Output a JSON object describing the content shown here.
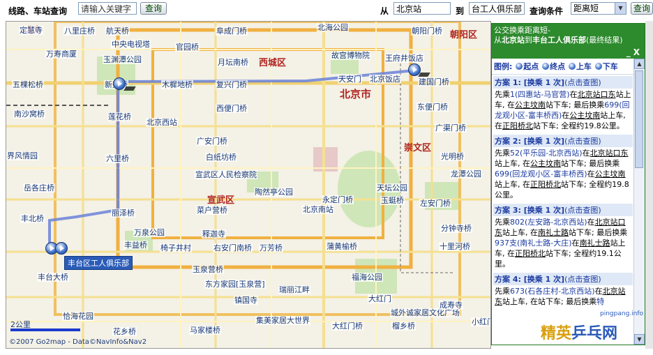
{
  "toolbar": {
    "route_label": "线路、车站查询",
    "keyword_value": "请输入关键字",
    "query_button": "查询",
    "from_label": "从",
    "from_value": "北京站",
    "to_label": "到",
    "to_value": "台工人俱乐部",
    "condition_label": "查询条件",
    "condition_value": "距离短",
    "query_button_2": "查询"
  },
  "map": {
    "districts": [
      "西城区",
      "朝阳区",
      "崇文区",
      "宣武区",
      "北京市",
      "北京"
    ],
    "places": [
      "定慧寺",
      "八里庄桥",
      "航天桥",
      "阜成门桥",
      "北海公园",
      "朝阳门桥",
      "中央电视塔",
      "官园桥",
      "玉渊潭公园",
      "故宫博物院",
      "王府井饭店",
      "万寿商厦",
      "月坛南桥",
      "新兴桥",
      "木樨地桥",
      "复兴门桥",
      "天安门",
      "北京饭店",
      "建国门桥",
      "五棵松桥",
      "北京西站",
      "西便门桥",
      "东便门桥",
      "莲花桥",
      "广安门桥",
      "广渠门桥",
      "白纸坊桥",
      "光明桥",
      "六里桥",
      "宣武区人民检察院",
      "天坛公园",
      "龙潭公园",
      "岳各庄桥",
      "陶然亭公园",
      "左安门桥",
      "永定门桥",
      "玉蜓桥",
      "丰北桥",
      "菜户营桥",
      "北京南站",
      "丽泽桥",
      "万泉公园",
      "分钟寺桥",
      "释迦寺",
      "丰益桥",
      "右安门南桥",
      "万芳桥",
      "蒲黄榆桥",
      "十里河桥",
      "椅子井村",
      "玉泉营桥",
      "丰台大桥",
      "东方家园[玉泉营]",
      "瑞丽江畔",
      "福海公园",
      "镇国寺",
      "大红门",
      "恰海花园",
      "集美家居大世界",
      "城外诚家居文化广场",
      "花乡桥",
      "马家楼桥",
      "大红门桥",
      "榴乡桥",
      "成寿寺",
      "小红门",
      "界风情园",
      "南沙窝桥"
    ],
    "end_label": "丰台区工人俱乐部",
    "scale_label": "2公里",
    "copyright": "©2007 Go2map - Data©NavInfo&Nav2"
  },
  "panel": {
    "header_line1": "公交换乘距离短-",
    "header_from_prefix": "从",
    "header_from": "北京站",
    "header_to_prefix": "到",
    "header_to": "丰台工人俱乐部",
    "header_suffix": "(最终结果)",
    "minimize": "_",
    "close": "X",
    "legend_label": "图例:",
    "legend_start": "起点",
    "legend_end": "终点",
    "legend_on": "上车",
    "legend_off": "下车",
    "schemes": [
      {
        "title": "方案 1: [换乘 1 次]",
        "link": "(点击查图)",
        "p1": "先乘",
        "bus1": "1(四惠站-马官营)",
        "p2": "在",
        "stop1": "北京站口东",
        "p3": "站上车, 在",
        "stop2": "公主坟南",
        "p4": "站下车; 最后换乘",
        "bus2": "699(回龙观小区-富丰桥西)",
        "p5": "在",
        "stop3": "公主坟南",
        "p6": "站上车, 在",
        "stop4": "正阳桥北",
        "p7": "站下车; 全程约19.8公里。"
      },
      {
        "title": "方案 2: [换乘 1 次]",
        "link": "(点击查图)",
        "p1": "先乘",
        "bus1": "52(平乐园-北京西站)",
        "p2": "在",
        "stop1": "北京站口东",
        "p3": "站上车, 在",
        "stop2": "公主坟南",
        "p4": "站下车; 最后换乘",
        "bus2": "699(回龙观小区-富丰桥西)",
        "p5": "在",
        "stop3": "公主坟南",
        "p6": "站上车, 在",
        "stop4": "正阳桥北",
        "p7": "站下车; 全程约19.8公里。"
      },
      {
        "title": "方案 3: [换乘 1 次]",
        "link": "(点击查图)",
        "p1": "先乘",
        "bus1": "802(左安路-北京西站)",
        "p2": "在",
        "stop1": "北京站口东",
        "p3": "站上车, 在",
        "stop2": "南礼士路",
        "p4": "站下车; 最后换乘",
        "bus2": "937支(南礼士路-大庄)",
        "p5": "在",
        "stop3": "南礼士路",
        "p6": "站上车, 在",
        "stop4": "正阳桥北",
        "p7": "站下车; 全程约19.1公里。"
      },
      {
        "title": "方案 4: [换乘 1 次]",
        "link": "(点击查图)",
        "p1": "先乘",
        "bus1": "673(石各庄村-北京西站)",
        "p2": "在",
        "stop1": "北京站东",
        "p3": "站上车, 在",
        "stop2": "",
        "p4": "站下车; 最后换乘",
        "bus2": "特",
        "p5": "",
        "stop3": "",
        "p6": "",
        "stop4": "",
        "p7": ""
      }
    ]
  },
  "watermark": {
    "text_a": "精英",
    "text_b": "乒乓网",
    "site": "pingpang.info"
  },
  "colors": {
    "panel_header": "#2d8a2d",
    "route_line": "#6a82d8",
    "district_red": "#b0241f",
    "link_blue": "#1a3aa0"
  }
}
